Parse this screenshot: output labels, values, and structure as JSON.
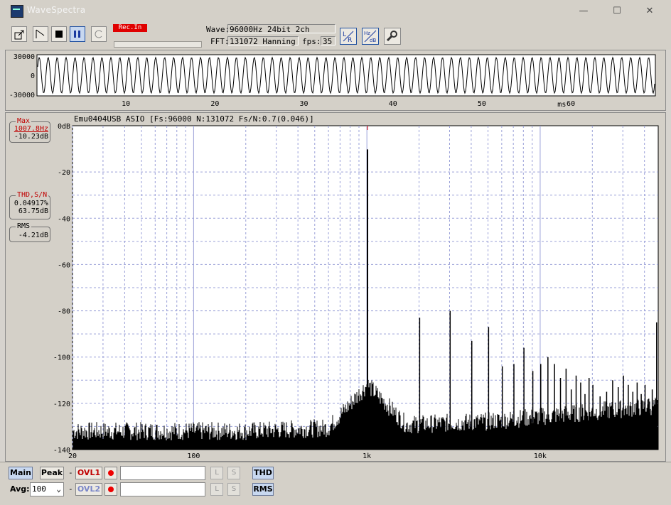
{
  "window": {
    "title": "WaveSpectra",
    "min": "—",
    "max": "☐",
    "close": "✕"
  },
  "toolbar": {
    "rec_badge": "Rec.In",
    "wave_label": "Wave:",
    "wave_value": "96000Hz 24bit 2ch",
    "fft_label": "FFT:",
    "fft_value": "131072 Hanning",
    "fps_label": "fps:",
    "fps_value": "35",
    "icons": [
      "export-icon",
      "trigger-icon",
      "stop-icon",
      "pause-icon",
      "refresh-icon",
      "lr-channel-icon",
      "hz-db-icon",
      "settings-wrench-icon"
    ]
  },
  "wave": {
    "yticks": [
      "30000",
      "0",
      "-30000"
    ],
    "xticks": [
      "10",
      "20",
      "30",
      "40",
      "50",
      "60"
    ],
    "xunit": "ms",
    "cycles": 69
  },
  "spectrum": {
    "header": "Emu0404USB ASIO  [Fs:96000 N:131072 Fs/N:0.7(0.046)]",
    "max_title": "Max",
    "max_freq": "1007.8Hz",
    "max_level": "-10.23dB",
    "thd_title": "THD,S/N",
    "thd_value": "0.04917%",
    "sn_value": "63.75dB",
    "rms_title": "RMS",
    "rms_value": "-4.21dB"
  },
  "chart_data": {
    "type": "line",
    "title": "",
    "xlabel": "",
    "ylabel": "",
    "x_scale": "log",
    "xlim": [
      20,
      48000
    ],
    "ylim": [
      -140,
      0
    ],
    "yticks": [
      "0dB",
      "-20",
      "-40",
      "-60",
      "-80",
      "-100",
      "-120",
      "-140"
    ],
    "xticks": [
      "20",
      "100",
      "1k",
      "10k"
    ],
    "grid": true,
    "peaks": [
      {
        "x": 1007.8,
        "y": -10.23
      },
      {
        "x": 2016,
        "y": -83
      },
      {
        "x": 3023,
        "y": -80
      },
      {
        "x": 4031,
        "y": -93
      },
      {
        "x": 5039,
        "y": -87
      },
      {
        "x": 6047,
        "y": -104
      },
      {
        "x": 7055,
        "y": -103
      },
      {
        "x": 8062,
        "y": -96
      },
      {
        "x": 9070,
        "y": -106
      },
      {
        "x": 10078,
        "y": -103
      },
      {
        "x": 11086,
        "y": -100
      },
      {
        "x": 12094,
        "y": -103
      },
      {
        "x": 13101,
        "y": -109
      },
      {
        "x": 14109,
        "y": -105
      },
      {
        "x": 15117,
        "y": -114
      },
      {
        "x": 16125,
        "y": -108
      },
      {
        "x": 17133,
        "y": -111
      },
      {
        "x": 18140,
        "y": -116
      },
      {
        "x": 19148,
        "y": -109
      },
      {
        "x": 20156,
        "y": -112
      },
      {
        "x": 22172,
        "y": -117
      },
      {
        "x": 24187,
        "y": -115
      },
      {
        "x": 26203,
        "y": -110
      },
      {
        "x": 28218,
        "y": -113
      },
      {
        "x": 30234,
        "y": -108
      },
      {
        "x": 32250,
        "y": -112
      },
      {
        "x": 34265,
        "y": -115
      },
      {
        "x": 36281,
        "y": -111
      },
      {
        "x": 38297,
        "y": -116
      },
      {
        "x": 40312,
        "y": -112
      },
      {
        "x": 42328,
        "y": -118
      },
      {
        "x": 44343,
        "y": -114
      },
      {
        "x": 47000,
        "y": -85
      }
    ],
    "noise_floor_db": -136,
    "line_color": "#000000",
    "max_marker_color": "#e00000",
    "grid_color": "#9aa0d8"
  },
  "bottom": {
    "main": "Main",
    "peak": "Peak",
    "dash": "-",
    "ovl1": "OVL1",
    "ovl2": "OVL2",
    "l": "L",
    "s": "S",
    "thd": "THD",
    "rms": "RMS",
    "avg_label": "Avg:",
    "avg_value": "100"
  },
  "colors": {
    "ovl1": "#c00000",
    "ovl2": "#7a86c8",
    "accent": "#c8d8f0"
  }
}
